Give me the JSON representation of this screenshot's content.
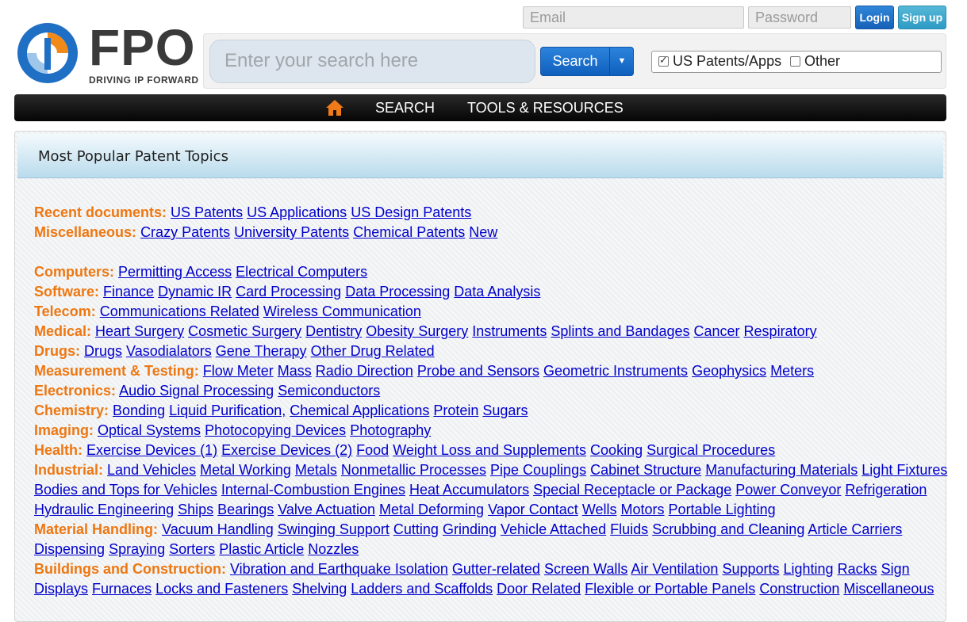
{
  "logo": {
    "text": "FPO",
    "tagline": "DRIVING IP FORWARD"
  },
  "auth": {
    "email_placeholder": "Email",
    "password_placeholder": "Password",
    "login_label": "Login",
    "signup_label": "Sign up"
  },
  "search": {
    "placeholder": "Enter your search here",
    "button_label": "Search",
    "filters": [
      {
        "label": "US Patents/Apps",
        "checked": true
      },
      {
        "label": "Other",
        "checked": false
      }
    ]
  },
  "nav": {
    "items": [
      "SEARCH",
      "TOOLS & RESOURCES"
    ]
  },
  "panel": {
    "title": "Most Popular Patent Topics"
  },
  "colors": {
    "category": "#ee7711",
    "link": "#0000cc",
    "nav_bg": "#111111",
    "accent_blue": "#1661b8"
  },
  "topics": {
    "r0": {
      "cat": "Recent documents:",
      "links": [
        "US Patents",
        "US Applications",
        "US Design Patents"
      ]
    },
    "r1": {
      "cat": "Miscellaneous:",
      "links": [
        "Crazy Patents",
        "University Patents",
        "Chemical Patents",
        "New"
      ]
    },
    "r2": {
      "cat": "Computers:",
      "links": [
        "Permitting Access",
        "Electrical Computers"
      ]
    },
    "r3": {
      "cat": "Software:",
      "links": [
        "Finance",
        "Dynamic IR",
        "Card Processing",
        "Data Processing",
        "Data Analysis"
      ]
    },
    "r4": {
      "cat": "Telecom:",
      "links": [
        "Communications Related",
        "Wireless Communication"
      ]
    },
    "r5": {
      "cat": "Medical:",
      "links": [
        "Heart Surgery",
        "Cosmetic Surgery",
        "Dentistry",
        "Obesity Surgery",
        "Instruments",
        "Splints and Bandages",
        "Cancer",
        "Respiratory"
      ]
    },
    "r6": {
      "cat": "Drugs:",
      "links": [
        "Drugs",
        "Vasodialators",
        "Gene Therapy",
        "Other Drug Related"
      ]
    },
    "r7": {
      "cat": "Measurement & Testing:",
      "links": [
        "Flow Meter",
        "Mass",
        "Radio Direction",
        "Probe and Sensors",
        "Geometric Instruments",
        "Geophysics",
        "Meters"
      ]
    },
    "r8": {
      "cat": "Electronics:",
      "links": [
        "Audio Signal Processing",
        "Semiconductors"
      ]
    },
    "r9": {
      "cat": "Chemistry:",
      "links": [
        "Bonding",
        "Liquid Purification,",
        "Chemical Applications",
        "Protein",
        "Sugars"
      ]
    },
    "r10": {
      "cat": "Imaging:",
      "links": [
        "Optical Systems",
        "Photocopying Devices",
        "Photography"
      ]
    },
    "r11": {
      "cat": "Health:",
      "links": [
        "Exercise Devices (1)",
        "Exercise Devices (2)",
        "Food",
        "Weight Loss and Supplements",
        "Cooking",
        "Surgical Procedures"
      ]
    },
    "r12": {
      "cat": "Industrial:",
      "links": [
        "Land Vehicles",
        "Metal Working",
        "Metals",
        "Nonmetallic Processes",
        "Pipe Couplings",
        "Cabinet Structure",
        "Manufacturing Materials",
        "Light Fixtures"
      ]
    },
    "r13": {
      "links": [
        "Bodies and Tops for Vehicles",
        "Internal-Combustion Engines",
        "Heat Accumulators",
        "Special Receptacle or Package",
        "Power Conveyor",
        "Refrigeration"
      ]
    },
    "r14": {
      "links": [
        "Hydraulic Engineering",
        "Ships",
        "Bearings",
        "Valve Actuation",
        "Metal Deforming",
        "Vapor Contact",
        "Wells",
        "Motors",
        "Portable Lighting"
      ]
    },
    "r15": {
      "cat": "Material Handling:",
      "links": [
        "Vacuum Handling",
        "Swinging Support",
        "Cutting",
        "Grinding",
        "Vehicle Attached",
        "Fluids",
        "Scrubbing and Cleaning",
        "Article Carriers"
      ]
    },
    "r16": {
      "links": [
        "Dispensing",
        "Spraying",
        "Sorters",
        "Plastic Article",
        "Nozzles"
      ]
    },
    "r17": {
      "cat": "Buildings and Construction:",
      "links": [
        "Vibration and Earthquake Isolation",
        "Gutter-related",
        "Screen Walls",
        "Air Ventilation",
        "Supports",
        "Lighting",
        "Racks",
        "Sign"
      ]
    },
    "r18": {
      "links": [
        "Displays",
        "Furnaces",
        "Locks and Fasteners",
        "Shelving",
        "Ladders and Scaffolds",
        "Door Related",
        "Flexible or Portable Panels",
        "Construction",
        "Miscellaneous"
      ]
    }
  }
}
